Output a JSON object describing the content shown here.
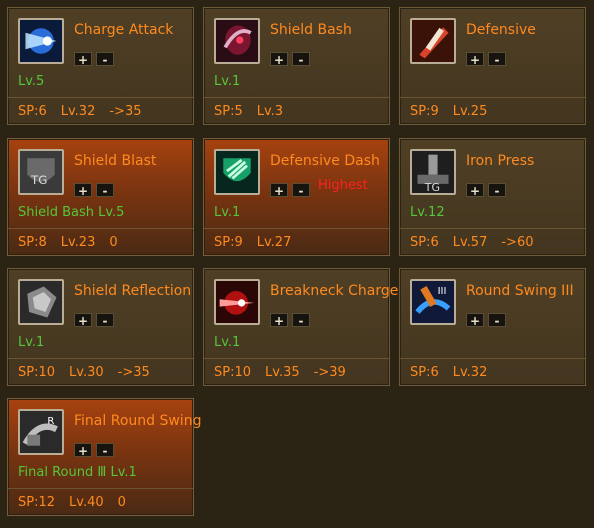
{
  "skills": [
    {
      "name": "Charge Attack",
      "req": "Lv.5",
      "sp": "SP:6",
      "lv": "Lv.32",
      "next": "->35",
      "icon": "charge-attack-icon",
      "highlight": false
    },
    {
      "name": "Shield Bash",
      "req": "Lv.1",
      "sp": "SP:5",
      "lv": "Lv.3",
      "next": "",
      "icon": "shield-bash-icon",
      "highlight": false
    },
    {
      "name": "Defensive",
      "req": "",
      "sp": "SP:9",
      "lv": "Lv.25",
      "next": "",
      "icon": "defensive-icon",
      "highlight": false
    },
    {
      "name": "Shield Blast",
      "req": "Shield Bash Lv.5",
      "sp": "SP:8",
      "lv": "Lv.23",
      "next": "0",
      "icon": "shield-blast-icon",
      "highlight": true
    },
    {
      "name": "Defensive Dash",
      "req": "Lv.1",
      "sp": "SP:9",
      "lv": "Lv.27",
      "next": "",
      "icon": "defensive-dash-icon",
      "highlight": true,
      "badge": "Highest"
    },
    {
      "name": "Iron Press",
      "req": "Lv.12",
      "sp": "SP:6",
      "lv": "Lv.57",
      "next": "->60",
      "icon": "iron-press-icon",
      "highlight": false
    },
    {
      "name": "Shield Reflection",
      "req": "Lv.1",
      "sp": "SP:10",
      "lv": "Lv.30",
      "next": "->35",
      "icon": "shield-reflection-icon",
      "highlight": false
    },
    {
      "name": "Breakneck Charge",
      "req": "Lv.1",
      "sp": "SP:10",
      "lv": "Lv.35",
      "next": "->39",
      "icon": "breakneck-charge-icon",
      "highlight": false
    },
    {
      "name": "Round Swing III",
      "req": "",
      "sp": "SP:6",
      "lv": "Lv.32",
      "next": "",
      "icon": "round-swing-icon",
      "highlight": false
    },
    {
      "name": "Final Round Swing",
      "req": "Final Round Ⅲ Lv.1",
      "sp": "SP:12",
      "lv": "Lv.40",
      "next": "0",
      "icon": "final-round-swing-icon",
      "highlight": true
    }
  ],
  "buttons": {
    "plus": "+",
    "minus": "-"
  }
}
